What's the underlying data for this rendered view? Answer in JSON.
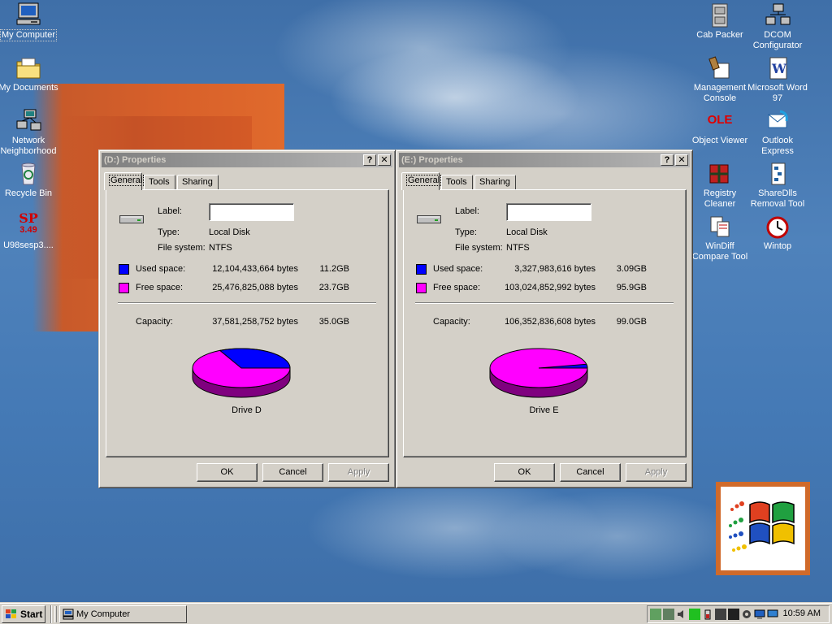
{
  "desktop": {
    "left_icons": [
      {
        "label": "My Computer",
        "icon": "my-computer-icon"
      },
      {
        "label": "My Documents",
        "icon": "my-documents-icon"
      },
      {
        "label": "Network Neighborhood",
        "icon": "network-icon"
      },
      {
        "label": "Recycle Bin",
        "icon": "recycle-bin-icon"
      },
      {
        "label": "U98sesp3....",
        "icon": "sp-installer-icon",
        "glyph_top": "SP",
        "glyph_bottom": "3.49"
      }
    ],
    "right_icons": [
      {
        "label": "Cab Packer",
        "icon": "cab-packer-icon"
      },
      {
        "label": "DCOM Configurator",
        "icon": "dcom-icon"
      },
      {
        "label": "Management Console",
        "icon": "mmc-icon"
      },
      {
        "label": "Microsoft Word 97",
        "icon": "word-icon"
      },
      {
        "label": "Object Viewer",
        "icon": "ole-viewer-icon",
        "glyph": "OLE"
      },
      {
        "label": "Outlook Express",
        "icon": "outlook-express-icon"
      },
      {
        "label": "Registry Cleaner",
        "icon": "registry-cleaner-icon"
      },
      {
        "label": "ShareDlls Removal Tool",
        "icon": "sharedlls-icon"
      },
      {
        "label": "WinDiff Compare Tool",
        "icon": "windiff-icon"
      },
      {
        "label": "Wintop",
        "icon": "wintop-icon"
      }
    ]
  },
  "dialogs": [
    {
      "title": "(D:) Properties",
      "tabs": [
        "General",
        "Tools",
        "Sharing"
      ],
      "label_caption": "Label:",
      "label_value": "",
      "type_caption": "Type:",
      "type_value": "Local Disk",
      "fs_caption": "File system:",
      "fs_value": "NTFS",
      "used_caption": "Used space:",
      "used_bytes": "12,104,433,664 bytes",
      "used_size": "11.2GB",
      "free_caption": "Free space:",
      "free_bytes": "25,476,825,088 bytes",
      "free_size": "23.7GB",
      "capacity_caption": "Capacity:",
      "capacity_bytes": "37,581,258,752 bytes",
      "capacity_size": "35.0GB",
      "drive_label": "Drive D",
      "used_value": 12104433664,
      "free_value": 25476825088,
      "buttons": {
        "ok": "OK",
        "cancel": "Cancel",
        "apply": "Apply"
      }
    },
    {
      "title": "(E:) Properties",
      "tabs": [
        "General",
        "Tools",
        "Sharing"
      ],
      "label_caption": "Label:",
      "label_value": "",
      "type_caption": "Type:",
      "type_value": "Local Disk",
      "fs_caption": "File system:",
      "fs_value": "NTFS",
      "used_caption": "Used space:",
      "used_bytes": "3,327,983,616 bytes",
      "used_size": "3.09GB",
      "free_caption": "Free space:",
      "free_bytes": "103,024,852,992 bytes",
      "free_size": "95.9GB",
      "capacity_caption": "Capacity:",
      "capacity_bytes": "106,352,836,608 bytes",
      "capacity_size": "99.0GB",
      "drive_label": "Drive E",
      "used_value": 3327983616,
      "free_value": 103024852992,
      "buttons": {
        "ok": "OK",
        "cancel": "Cancel",
        "apply": "Apply"
      }
    }
  ],
  "colors": {
    "used": "#0000ff",
    "free": "#ff00ff",
    "used_dark": "#00007f",
    "free_dark": "#7f007f"
  },
  "taskbar": {
    "start_label": "Start",
    "task_label": "My Computer",
    "clock": "10:59 AM",
    "tray_icons": [
      "network-tray-icon",
      "tool-tray-icon",
      "volume-icon",
      "monitor-tray-icon",
      "battery-icon",
      "task-scheduler-icon",
      "film-icon",
      "gear-tray-icon",
      "display-tray-icon",
      "computer-tray-icon",
      "shield-tray-icon"
    ]
  }
}
